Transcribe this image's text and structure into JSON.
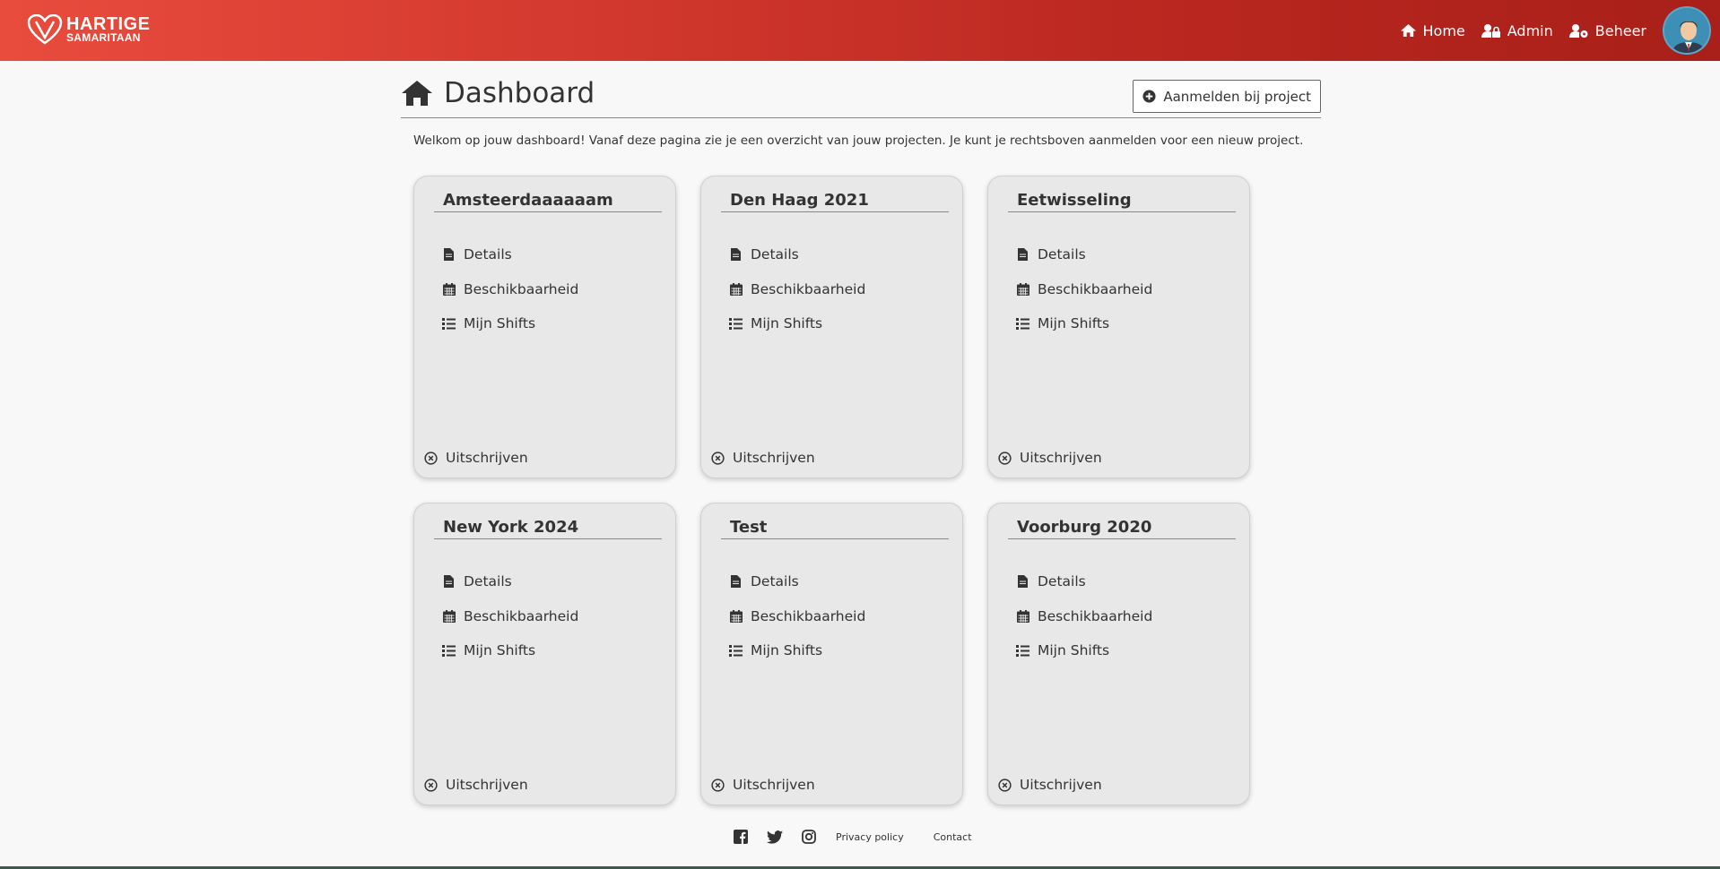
{
  "header": {
    "logo_line1": "HARTIGE",
    "logo_line2": "SAMARITAAN",
    "nav": [
      {
        "label": "Home",
        "icon": "home-icon"
      },
      {
        "label": "Admin",
        "icon": "user-lock-icon"
      },
      {
        "label": "Beheer",
        "icon": "user-cog-icon"
      }
    ],
    "avatar_icon": "avatar"
  },
  "page": {
    "title": "Dashboard",
    "enroll_label": "Aanmelden bij project",
    "welcome": "Welkom op jouw dashboard! Vanaf deze pagina zie je een overzicht van jouw projecten. Je kunt je rechtsboven aanmelden voor een nieuw project."
  },
  "cards": [
    {
      "title": "Amsteerdaaaaaam",
      "links": [
        "Details",
        "Beschikbaarheid",
        "Mijn Shifts"
      ],
      "unsubscribe": "Uitschrijven"
    },
    {
      "title": "Den Haag 2021",
      "links": [
        "Details",
        "Beschikbaarheid",
        "Mijn Shifts"
      ],
      "unsubscribe": "Uitschrijven"
    },
    {
      "title": "Eetwisseling",
      "links": [
        "Details",
        "Beschikbaarheid",
        "Mijn Shifts"
      ],
      "unsubscribe": "Uitschrijven"
    },
    {
      "title": "New York 2024",
      "links": [
        "Details",
        "Beschikbaarheid",
        "Mijn Shifts"
      ],
      "unsubscribe": "Uitschrijven"
    },
    {
      "title": "Test",
      "links": [
        "Details",
        "Beschikbaarheid",
        "Mijn Shifts"
      ],
      "unsubscribe": "Uitschrijven"
    },
    {
      "title": "Voorburg 2020",
      "links": [
        "Details",
        "Beschikbaarheid",
        "Mijn Shifts"
      ],
      "unsubscribe": "Uitschrijven"
    }
  ],
  "footer": {
    "privacy": "Privacy policy",
    "contact": "Contact",
    "social": [
      "facebook-icon",
      "twitter-icon",
      "instagram-icon"
    ]
  },
  "colors": {
    "header_start": "#e84c3d",
    "header_end": "#a82019",
    "card_bg": "#e8e8e8",
    "text": "#333333"
  }
}
